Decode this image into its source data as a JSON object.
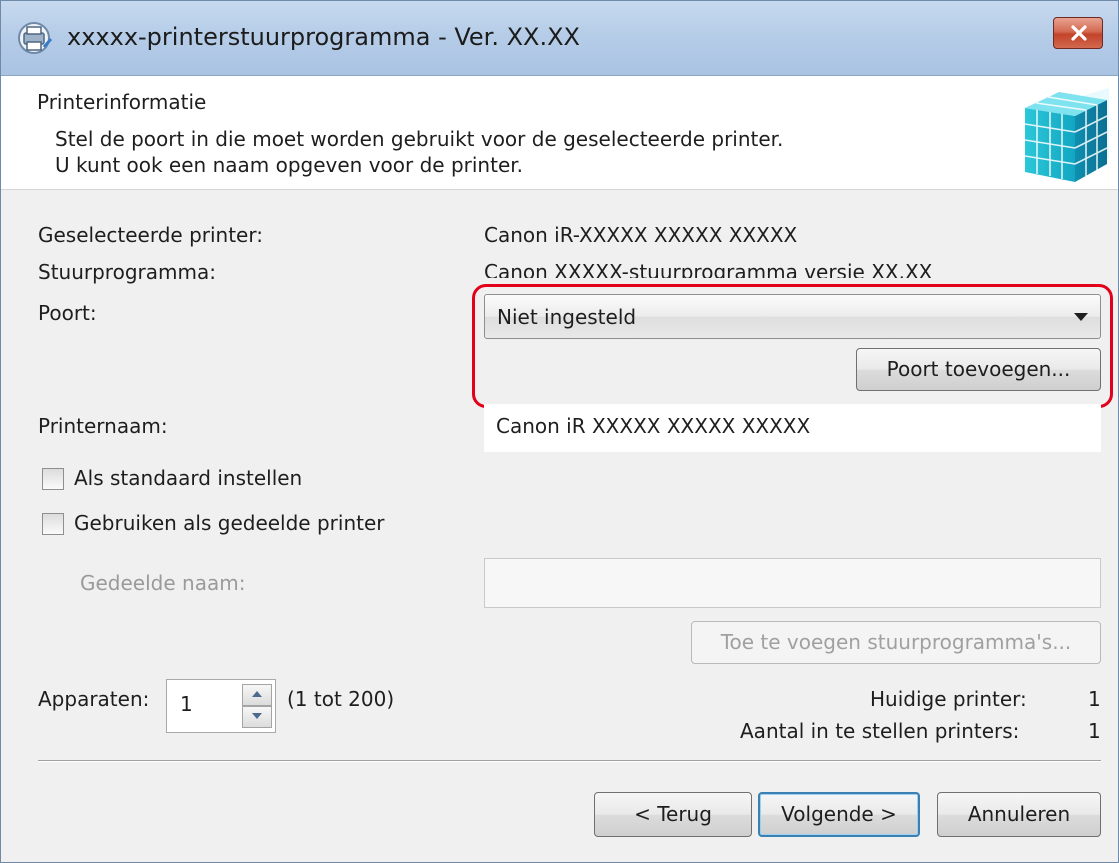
{
  "window": {
    "title": "xxxxx-printerstuurprogramma - Ver. XX.XX"
  },
  "header": {
    "title": "Printerinformatie",
    "desc_line1": "Stel de poort in die moet worden gebruikt voor de geselecteerde printer.",
    "desc_line2": "U kunt ook een naam opgeven voor de printer."
  },
  "form": {
    "selected_printer_label": "Geselecteerde printer:",
    "selected_printer_value": "Canon iR-XXXXX XXXXX XXXXX",
    "driver_label": "Stuurprogramma:",
    "driver_value": "Canon XXXXX-stuurprogramma versie XX.XX",
    "port_label": "Poort:",
    "port_selected": "Niet ingesteld",
    "add_port_button": "Poort toevoegen...",
    "printer_name_label": "Printernaam:",
    "printer_name_value": "Canon iR XXXXX XXXXX XXXXX",
    "set_default_label": "Als standaard instellen",
    "set_default_checked": false,
    "use_shared_label": "Gebruiken als gedeelde printer",
    "use_shared_checked": false,
    "shared_name_label": "Gedeelde naam:",
    "shared_name_value": "",
    "add_drivers_button": "Toe te voegen stuurprogramma's...",
    "devices_label": "Apparaten:",
    "devices_value": "1",
    "devices_range": "(1 tot 200)",
    "current_printer_label": "Huidige printer:",
    "current_printer_value": "1",
    "printers_to_set_label": "Aantal in te stellen printers:",
    "printers_to_set_value": "1"
  },
  "footer": {
    "back_button": "< Terug",
    "next_button": "Volgende >",
    "cancel_button": "Annuleren"
  },
  "colors": {
    "highlight_frame": "#e2001a",
    "titlebar": "#b6cde8",
    "close_button": "#c2432a"
  }
}
